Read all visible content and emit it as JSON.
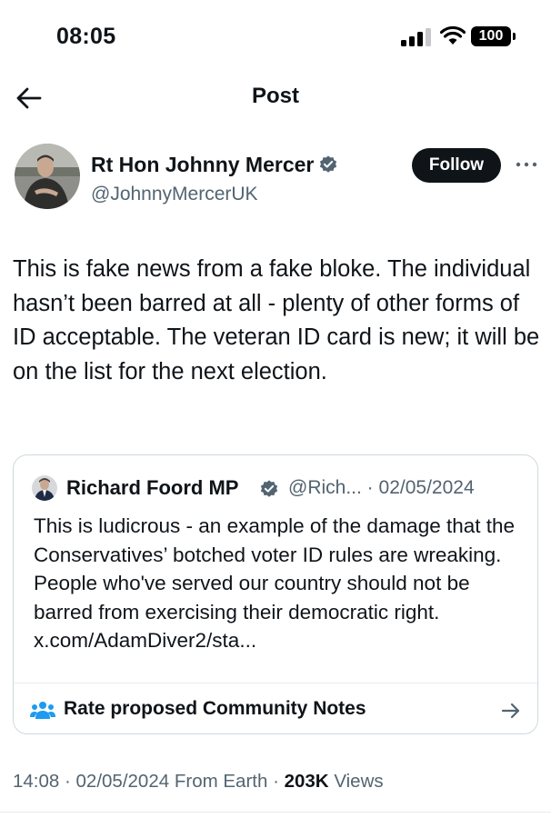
{
  "status_bar": {
    "time": "08:05",
    "battery": "100",
    "icons": [
      "cellular-signal-icon",
      "wifi-icon",
      "battery-icon"
    ]
  },
  "header": {
    "title": "Post",
    "back_icon": "arrow-left-icon"
  },
  "post": {
    "author": {
      "name": "Rt Hon Johnny Mercer",
      "handle": "@JohnnyMercerUK",
      "verified": true
    },
    "follow_label": "Follow",
    "more_icon": "more-dots-icon",
    "text": "This is fake news from a fake bloke. The individual hasn’t been barred at all - plenty of other forms of ID acceptable. The veteran ID card is new; it will be on the list for the next election.",
    "quoted": {
      "author_name": "Richard Foord MP",
      "handle": "@Rich...",
      "separator": " · ",
      "date": "02/05/2024",
      "verified": true,
      "text": "This is ludicrous - an example of the damage that the Conservatives’ botched voter ID rules are wreaking. People who've served our country should not be barred from exercising their democratic right. x.com/AdamDiver2/sta...",
      "notes_label": "Rate proposed Community Notes",
      "notes_icon": "people-icon",
      "notes_arrow_icon": "arrow-right-icon"
    },
    "meta": {
      "time": "14:08",
      "date": "02/05/2024",
      "source": "From Earth",
      "views_count": "203K",
      "views_label": "Views",
      "sep1": " · ",
      "sep2": " · "
    }
  },
  "colors": {
    "text_primary": "#0f1419",
    "text_secondary": "#536471",
    "verified_blue": "#1d9bf0",
    "border": "#cfd9de",
    "follow_bg": "#0f1419",
    "community_icon": "#1d9bf0"
  }
}
